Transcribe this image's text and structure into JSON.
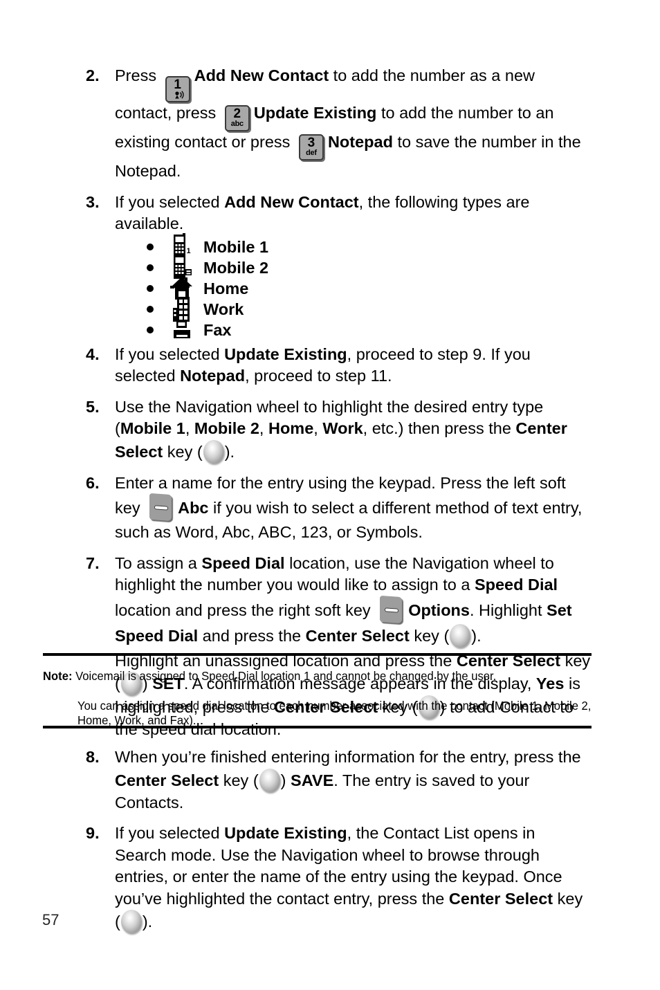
{
  "document": {
    "page_number": "57",
    "page_background": "#ffffff",
    "text_color": "#000000"
  },
  "steps": [
    {
      "number": "2.",
      "segments": [
        {
          "t": "Press ",
          "b": false
        },
        {
          "t": "key-1",
          "icon": "keypad-key-1"
        },
        {
          "t": "Add New Contact",
          "b": true
        },
        {
          "t": " to add the number as a new contact, press ",
          "b": false
        },
        {
          "t": "key-2",
          "icon": "keypad-key-2"
        },
        {
          "t": "Update Existing",
          "b": true
        },
        {
          "t": " to add the number to an existing contact or press ",
          "b": false
        },
        {
          "t": "key-3",
          "icon": "keypad-key-3"
        },
        {
          "t": "Notepad",
          "b": true
        },
        {
          "t": " to save the number in the Notepad.",
          "b": false
        }
      ]
    },
    {
      "number": "3.",
      "segments": [
        {
          "t": "If you selected ",
          "b": false
        },
        {
          "t": "Add New Contact",
          "b": true
        },
        {
          "t": ", the following types are available.",
          "b": false
        }
      ]
    },
    {
      "number": "4.",
      "segments": [
        {
          "t": "If you selected ",
          "b": false
        },
        {
          "t": "Update Existing",
          "b": true
        },
        {
          "t": ", proceed to step 9. If you selected ",
          "b": false
        },
        {
          "t": "Notepad",
          "b": true
        },
        {
          "t": ", proceed to step 11.",
          "b": false
        }
      ]
    },
    {
      "number": "5.",
      "segments": [
        {
          "t": "Use the Navigation wheel to highlight the desired entry type (",
          "b": false
        },
        {
          "t": "Mobile 1",
          "b": true
        },
        {
          "t": ", ",
          "b": false
        },
        {
          "t": "Mobile 2",
          "b": true
        },
        {
          "t": ", ",
          "b": false
        },
        {
          "t": "Home",
          "b": true
        },
        {
          "t": ", ",
          "b": false
        },
        {
          "t": "Work",
          "b": true
        },
        {
          "t": ", etc.) then press the ",
          "b": false
        },
        {
          "t": "Center Select",
          "b": true
        },
        {
          "t": " key (",
          "b": false
        },
        {
          "t": "select-key",
          "icon": "center-select-key"
        },
        {
          "t": ").",
          "b": false
        }
      ]
    },
    {
      "number": "6.",
      "segments": [
        {
          "t": "Enter a name for the entry using the keypad. Press the left soft key ",
          "b": false
        },
        {
          "t": "soft-key",
          "icon": "soft-key"
        },
        {
          "t": "Abc",
          "b": true
        },
        {
          "t": " if you wish to select a different method of text entry, such as Word, Abc, ABC, 123, or Symbols.",
          "b": false
        }
      ]
    },
    {
      "number": "7.",
      "segments": [
        {
          "t": "To assign a ",
          "b": false
        },
        {
          "t": "Speed Dial",
          "b": true
        },
        {
          "t": " location, use the Navigation wheel to highlight the number you would like to assign to a ",
          "b": false
        },
        {
          "t": "Speed Dial",
          "b": true
        },
        {
          "t": " location and press the right soft key ",
          "b": false
        },
        {
          "t": "soft-key",
          "icon": "soft-key"
        },
        {
          "t": "Options",
          "b": true
        },
        {
          "t": ". Highlight ",
          "b": false
        },
        {
          "t": "Set Speed Dial",
          "b": true
        },
        {
          "t": " and press the ",
          "b": false
        },
        {
          "t": "Center Select",
          "b": true
        },
        {
          "t": " key (",
          "b": false
        },
        {
          "t": "select-key",
          "icon": "center-select-key"
        },
        {
          "t": ").",
          "b": false
        }
      ]
    },
    {
      "number": "8.",
      "segments": [
        {
          "t": "When you’re finished entering information for the entry, press the ",
          "b": false
        },
        {
          "t": "Center Select",
          "b": true
        },
        {
          "t": " key (",
          "b": false
        },
        {
          "t": "select-key",
          "icon": "center-select-key"
        },
        {
          "t": ") ",
          "b": false
        },
        {
          "t": "SAVE",
          "b": true
        },
        {
          "t": ". The entry is saved to your Contacts.",
          "b": false
        }
      ]
    },
    {
      "number": "9.",
      "segments": [
        {
          "t": "If you selected ",
          "b": false
        },
        {
          "t": "Update Existing",
          "b": true
        },
        {
          "t": ", the Contact List opens in Search mode. Use the Navigation wheel to browse through entries, or enter the name of the entry using the keypad. Once you’ve highlighted the contact entry, press the ",
          "b": false
        },
        {
          "t": "Center Select",
          "b": true
        },
        {
          "t": " key (",
          "b": false
        },
        {
          "t": "select-key",
          "icon": "center-select-key"
        },
        {
          "t": ").",
          "b": false
        }
      ]
    }
  ],
  "step7_continuation": [
    {
      "t": "Highlight an unassigned location and press the ",
      "b": false
    },
    {
      "t": "Center Select",
      "b": true
    },
    {
      "t": " key (",
      "b": false
    },
    {
      "t": "select-key",
      "icon": "center-select-key"
    },
    {
      "t": ") ",
      "b": false
    },
    {
      "t": "SET",
      "b": true
    },
    {
      "t": ". A confirmation message appears in the display, ",
      "b": false
    },
    {
      "t": "Yes",
      "b": true
    },
    {
      "t": " is highlighted, press the ",
      "b": false
    },
    {
      "t": "Center Select",
      "b": true
    },
    {
      "t": " key (",
      "b": false
    },
    {
      "t": "select-key",
      "icon": "center-select-key"
    },
    {
      "t": ") to add Contact to the speed dial location.",
      "b": false
    }
  ],
  "contact_types": [
    {
      "label": "Mobile 1",
      "icon": "mobile-phone-1-icon"
    },
    {
      "label": "Mobile 2",
      "icon": "mobile-phone-2-icon"
    },
    {
      "label": "Home",
      "icon": "house-icon"
    },
    {
      "label": "Work",
      "icon": "office-building-icon"
    },
    {
      "label": "Fax",
      "icon": "fax-machine-icon"
    }
  ],
  "note": {
    "label": "Note:",
    "text": "Voicemail is assigned to Speed Dial location 1 and cannot be changed by the user.",
    "secondary": "You can assign a speed dial location to each number associated with the contact (Mobile 1, Mobile 2, Home, Work, and Fax)."
  },
  "keypad_keys": {
    "key1": {
      "number": "1",
      "sub": ""
    },
    "key2": {
      "number": "2",
      "sub": "abc"
    },
    "key3": {
      "number": "3",
      "sub": "def"
    }
  }
}
